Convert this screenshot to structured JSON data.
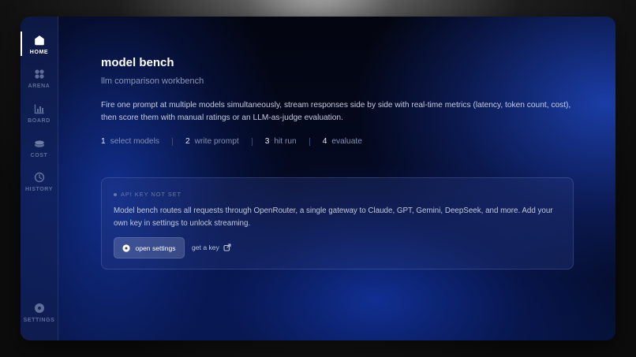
{
  "sidebar": {
    "items": [
      {
        "label": "HOME",
        "icon": "home-icon",
        "active": true
      },
      {
        "label": "ARENA",
        "icon": "grid-icon",
        "active": false
      },
      {
        "label": "BOARD",
        "icon": "bar-chart-icon",
        "active": false
      },
      {
        "label": "COST",
        "icon": "coins-icon",
        "active": false
      },
      {
        "label": "HISTORY",
        "icon": "history-icon",
        "active": false
      }
    ],
    "settings": {
      "label": "SETTINGS",
      "icon": "settings-icon"
    }
  },
  "main": {
    "title": "model bench",
    "subtitle": "llm comparison workbench",
    "description": "Fire one prompt at multiple models simultaneously, stream responses side by side with real-time metrics (latency, token count, cost), then score them with manual ratings or an LLM-as-judge evaluation.",
    "steps": [
      {
        "num": "1",
        "label": "select models"
      },
      {
        "num": "2",
        "label": "write prompt"
      },
      {
        "num": "3",
        "label": "hit run"
      },
      {
        "num": "4",
        "label": "evaluate"
      }
    ]
  },
  "api_card": {
    "status": "API KEY NOT SET",
    "message": "Model bench routes all requests through OpenRouter, a single gateway to Claude, GPT, Gemini, DeepSeek, and more. Add your own key in settings to unlock streaming.",
    "primary_button": "open settings",
    "link_button": "get a key"
  },
  "colors": {
    "accent": "#1e46be",
    "text_primary": "#ffffff",
    "text_muted": "#8a96b8"
  }
}
